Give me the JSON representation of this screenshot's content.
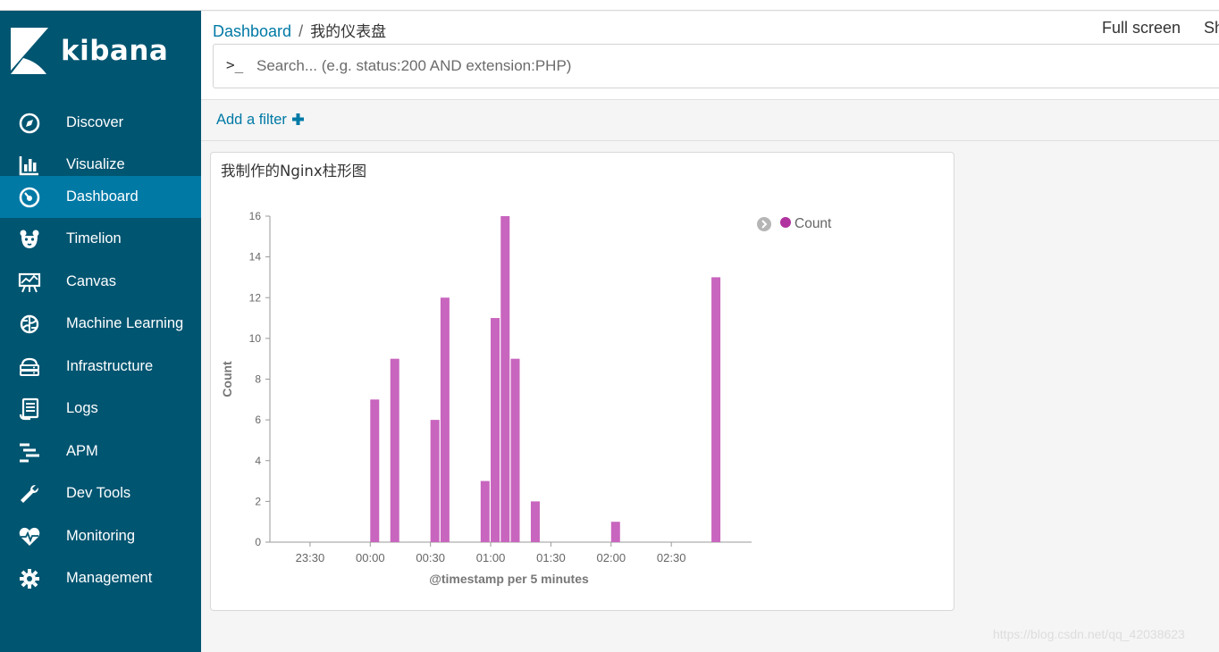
{
  "app": {
    "brand": "kibana"
  },
  "colors": {
    "sidebar_bg": "#005571",
    "active_bg": "#0079a5",
    "accent": "#0079a5",
    "bar": "#c865be",
    "legend_dot": "#b0339f"
  },
  "sidebar": {
    "items": [
      {
        "label": "Discover",
        "icon": "compass-icon",
        "active": false
      },
      {
        "label": "Visualize",
        "icon": "bar-chart-icon",
        "active": false
      },
      {
        "label": "Dashboard",
        "icon": "gauge-icon",
        "active": true
      },
      {
        "label": "Timelion",
        "icon": "bear-icon",
        "active": false
      },
      {
        "label": "Canvas",
        "icon": "easel-icon",
        "active": false
      },
      {
        "label": "Machine Learning",
        "icon": "brain-icon",
        "active": false
      },
      {
        "label": "Infrastructure",
        "icon": "server-cloud-icon",
        "active": false
      },
      {
        "label": "Logs",
        "icon": "log-document-icon",
        "active": false
      },
      {
        "label": "APM",
        "icon": "apm-lines-icon",
        "active": false
      },
      {
        "label": "Dev Tools",
        "icon": "wrench-icon",
        "active": false
      },
      {
        "label": "Monitoring",
        "icon": "heartbeat-icon",
        "active": false
      },
      {
        "label": "Management",
        "icon": "gear-icon",
        "active": false
      }
    ]
  },
  "header": {
    "breadcrumb_root": "Dashboard",
    "breadcrumb_sep": "/",
    "breadcrumb_current": "我的仪表盘",
    "fullscreen_label": "Full screen",
    "share_label": "Sh"
  },
  "search": {
    "prompt": ">_",
    "placeholder": "Search... (e.g. status:200 AND extension:PHP)",
    "value": ""
  },
  "filter": {
    "add_label": "Add a filter",
    "add_icon": "plus-icon"
  },
  "panel": {
    "title": "我制作的Nginx柱形图"
  },
  "watermark": "https://blog.csdn.net/qq_42038623",
  "chart_data": {
    "type": "bar",
    "xlabel": "@timestamp per 5 minutes",
    "ylabel": "Count",
    "ylim": [
      0,
      16
    ],
    "yticks": [
      0,
      2,
      4,
      6,
      8,
      10,
      12,
      14,
      16
    ],
    "xticks": [
      "23:30",
      "00:00",
      "00:30",
      "01:00",
      "01:30",
      "02:00",
      "02:30"
    ],
    "legend": {
      "position": "top-right",
      "entries": [
        "Count"
      ]
    },
    "series": [
      {
        "name": "Count",
        "x": [
          "00:00",
          "00:10",
          "00:30",
          "00:35",
          "00:55",
          "01:00",
          "01:05",
          "01:10",
          "01:20",
          "02:00",
          "02:50"
        ],
        "values": [
          7,
          9,
          6,
          12,
          3,
          11,
          16,
          9,
          2,
          1,
          13
        ]
      }
    ]
  }
}
